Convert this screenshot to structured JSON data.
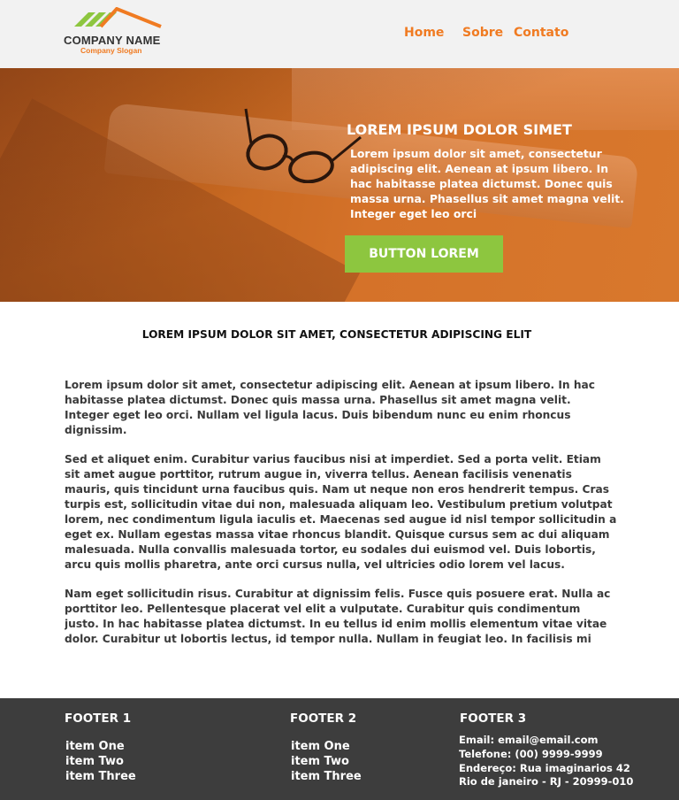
{
  "header": {
    "logo": {
      "name": "COMPANY NAME",
      "slogan": "Company Slogan",
      "icon": "roof-stripes-logo-icon"
    },
    "nav": [
      {
        "label": "Home"
      },
      {
        "label": "Sobre"
      },
      {
        "label": "Contato"
      }
    ]
  },
  "hero": {
    "title": "LOREM IPSUM DOLOR SIMET",
    "text": "Lorem ipsum dolor sit amet, consectetur adipiscing elit. Aenean at ipsum libero. In hac habitasse platea dictumst. Donec quis massa urna. Phasellus sit amet magna velit. Integer eget leo orci",
    "button_label": "BUTTON LOREM"
  },
  "main": {
    "heading": "LOREM IPSUM DOLOR SIT AMET, CONSECTETUR ADIPISCING ELIT",
    "paragraphs": [
      "Lorem ipsum dolor sit amet, consectetur adipiscing elit. Aenean at ipsum libero. In hac habitasse platea dictumst. Donec quis massa urna. Phasellus sit amet magna velit. Integer eget leo orci. Nullam vel ligula lacus. Duis bibendum nunc eu enim rhoncus dignissim.",
      "Sed et aliquet enim. Curabitur varius faucibus nisi at imperdiet. Sed a porta velit. Etiam sit amet augue porttitor, rutrum augue in, viverra tellus. Aenean facilisis venenatis mauris, quis tincidunt urna faucibus quis. Nam ut neque non eros hendrerit tempus. Cras turpis est, sollicitudin vitae dui non, malesuada aliquam leo. Vestibulum pretium volutpat lorem, nec condimentum ligula iaculis et. Maecenas sed augue id nisl tempor sollicitudin a eget ex. Nullam egestas massa vitae rhoncus blandit. Quisque cursus sem ac dui aliquam malesuada. Nulla convallis malesuada tortor, eu sodales dui euismod vel. Duis lobortis, arcu quis mollis pharetra, ante orci cursus nulla, vel ultricies odio lorem vel lacus.",
      "Nam eget sollicitudin risus. Curabitur at dignissim felis. Fusce quis posuere erat. Nulla ac porttitor leo. Pellentesque placerat vel elit a vulputate. Curabitur quis condimentum justo. In hac habitasse platea dictumst. In eu tellus id enim mollis elementum vitae vitae dolor. Curabitur ut lobortis lectus, id tempor nulla. Nullam in feugiat leo. In facilisis mi"
    ]
  },
  "footer": {
    "col1": {
      "title": "FOOTER 1",
      "items": [
        "item One",
        "item Two",
        "item Three"
      ]
    },
    "col2": {
      "title": "FOOTER 2",
      "items": [
        "item One",
        "item Two",
        "item Three"
      ]
    },
    "col3": {
      "title": "FOOTER 3",
      "email": "Email: email@email.com",
      "phone": "Telefone: (00) 9999-9999",
      "address": "Endereço: Rua imaginarios 42",
      "city": "Rio de janeiro - RJ - 20999-010"
    }
  },
  "colors": {
    "accent": "#f07b22",
    "button": "#8dc63f",
    "header_bg": "#f2f2f2",
    "footer_bg": "#3d3d3d"
  }
}
